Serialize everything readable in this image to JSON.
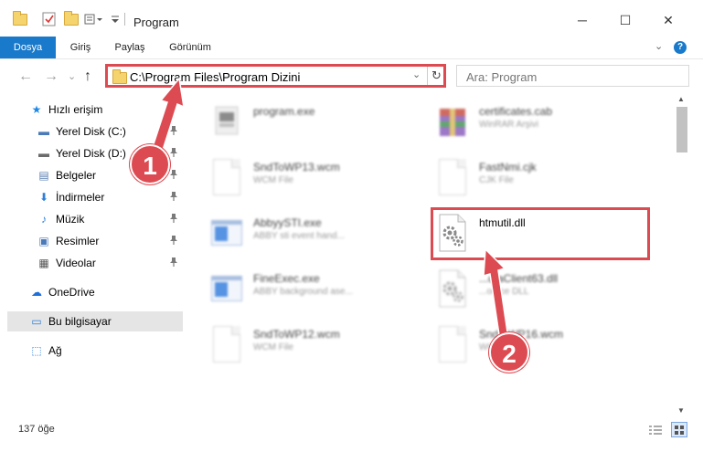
{
  "window": {
    "title": "Program",
    "minimize": "─",
    "maximize": "☐",
    "close": "✕"
  },
  "ribbon": {
    "tabs": [
      "Dosya",
      "Giriş",
      "Paylaş",
      "Görünüm"
    ],
    "expand": "⌄",
    "help": "?"
  },
  "nav": {
    "back": "←",
    "forward": "→",
    "up_dropdown": "⌄",
    "up": "↑",
    "address": "C:\\Program Files\\Program Dizini",
    "address_dropdown": "⌄",
    "refresh": "↻",
    "search_placeholder": "Ara: Program"
  },
  "sidebar": {
    "items": [
      {
        "label": "Hızlı erişim",
        "icon": "star-icon",
        "glyph": "★",
        "color": "#1e88e5",
        "pinned": false,
        "selected": false
      },
      {
        "label": "Yerel Disk (C:)",
        "icon": "drive-icon",
        "glyph": "▬",
        "color": "#4a7ab8",
        "pinned": true,
        "selected": false
      },
      {
        "label": "Yerel Disk (D:)",
        "icon": "drive-icon",
        "glyph": "▬",
        "color": "#6b6b6b",
        "pinned": true,
        "selected": false
      },
      {
        "label": "Belgeler",
        "icon": "documents-icon",
        "glyph": "▤",
        "color": "#5b7fb1",
        "pinned": true,
        "selected": false
      },
      {
        "label": "İndirmeler",
        "icon": "download-icon",
        "glyph": "⬇",
        "color": "#2f7fd8",
        "pinned": true,
        "selected": false
      },
      {
        "label": "Müzik",
        "icon": "music-icon",
        "glyph": "♪",
        "color": "#2f7fd8",
        "pinned": true,
        "selected": false
      },
      {
        "label": "Resimler",
        "icon": "pictures-icon",
        "glyph": "▣",
        "color": "#4a7ab8",
        "pinned": true,
        "selected": false
      },
      {
        "label": "Videolar",
        "icon": "videos-icon",
        "glyph": "▦",
        "color": "#555555",
        "pinned": true,
        "selected": false
      },
      {
        "label": "OneDrive",
        "icon": "cloud-icon",
        "glyph": "☁",
        "color": "#1e6fd9",
        "pinned": false,
        "selected": false
      },
      {
        "label": "Bu bilgisayar",
        "icon": "computer-icon",
        "glyph": "▭",
        "color": "#2f7fd8",
        "pinned": false,
        "selected": true
      },
      {
        "label": "Ağ",
        "icon": "network-icon",
        "glyph": "⬚",
        "color": "#2f7fd8",
        "pinned": false,
        "selected": false
      }
    ],
    "pin_glyph": "📌"
  },
  "files": [
    {
      "name": "program.exe",
      "type": "",
      "icon": "exe-icon",
      "blurred": true
    },
    {
      "name": "certificates.cab",
      "type": "WinRAR Arşivi",
      "icon": "archive-icon",
      "blurred": true
    },
    {
      "name": "SndToWP13.wcm",
      "type": "WCM File",
      "icon": "document-icon",
      "blurred": true
    },
    {
      "name": "FastNmi.cjk",
      "type": "CJK File",
      "icon": "document-icon",
      "blurred": true
    },
    {
      "name": "AbbyySTI.exe",
      "type": "ABBY sti event hand...",
      "icon": "app-icon",
      "blurred": true
    },
    {
      "name": "htmutil.dll",
      "type": "",
      "icon": "dll-gear-icon",
      "blurred": false
    },
    {
      "name": "FineExec.exe",
      "type": "ABBY background ase...",
      "icon": "app-icon",
      "blurred": true
    },
    {
      "name": "...dtaClient63.dll",
      "type": "...ource DLL",
      "icon": "dll-gear-icon",
      "blurred": true
    },
    {
      "name": "SndToWP12.wcm",
      "type": "WCM File",
      "icon": "document-icon",
      "blurred": true
    },
    {
      "name": "Snd...WP16.wcm",
      "type": "WCM File",
      "icon": "document-icon",
      "blurred": true
    }
  ],
  "status": {
    "count": "137 öğe"
  },
  "annotations": {
    "step1": "1",
    "step2": "2",
    "color": "#dd4b52"
  }
}
